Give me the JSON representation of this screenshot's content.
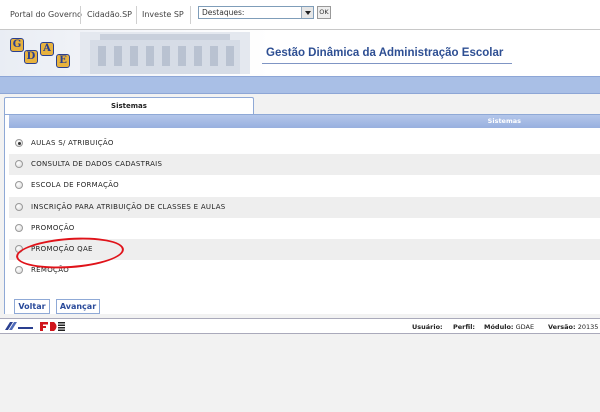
{
  "topbar": {
    "links": [
      "Portal do Governo",
      "Cidadão.SP",
      "Investe SP"
    ],
    "destaques_value": "Destaques:",
    "ok_label": "OK"
  },
  "banner": {
    "logo_letters": [
      "G",
      "D",
      "A",
      "E"
    ],
    "title": "Gestão Dinâmica da Administração Escolar"
  },
  "tab": {
    "label": "Sistemas"
  },
  "panel": {
    "header": "Sistemas"
  },
  "options": [
    {
      "label": "AULAS S/ ATRIBUIÇÃO",
      "checked": true
    },
    {
      "label": "CONSULTA DE DADOS CADASTRAIS",
      "checked": false
    },
    {
      "label": "ESCOLA DE FORMAÇÃO",
      "checked": false
    },
    {
      "label": "INSCRIÇÃO PARA ATRIBUIÇÃO DE CLASSES E AULAS",
      "checked": false
    },
    {
      "label": "PROMOÇÃO",
      "checked": false
    },
    {
      "label": "PROMOÇÃO QAE",
      "checked": false
    },
    {
      "label": "REMOÇÃO",
      "checked": false
    }
  ],
  "buttons": {
    "back": "Voltar",
    "next": "Avançar"
  },
  "footer": {
    "usuario_label": "Usuário:",
    "perfil_label": "Perfil:",
    "modulo_label": "Módulo:",
    "modulo_value": "GDAE",
    "versao_label": "Versão:",
    "versao_value": "20135"
  },
  "colors": {
    "accent": "#2e4f93",
    "stripe": "#a9bfe6",
    "annotation": "#e0131a"
  }
}
